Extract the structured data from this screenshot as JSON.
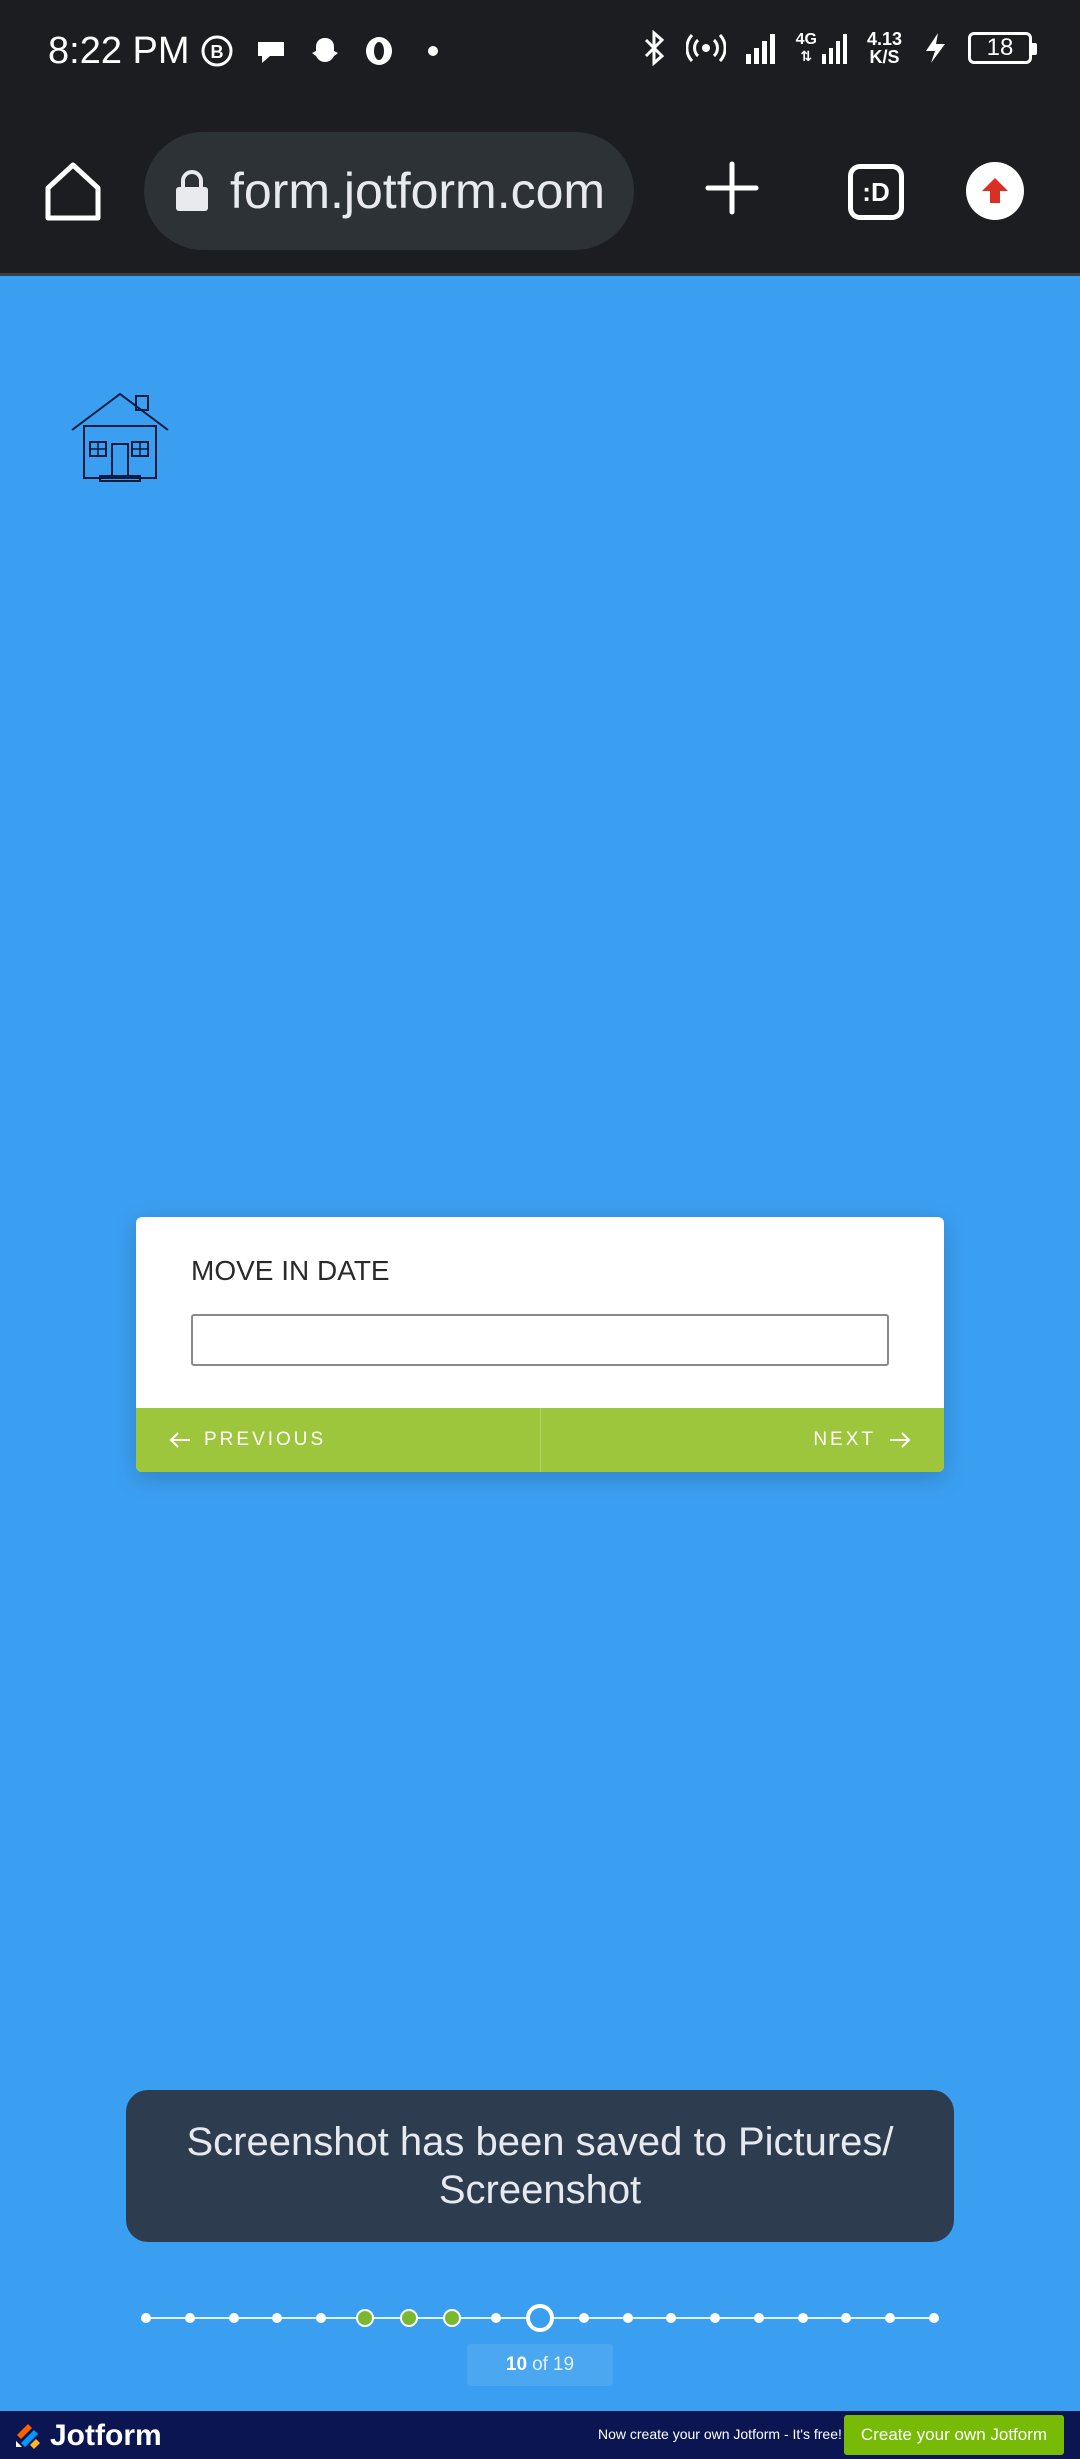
{
  "status_bar": {
    "time": "8:22 PM",
    "net_speed_value": "4.13",
    "net_speed_unit": "K/S",
    "network_type": "4G",
    "battery": "18",
    "left_icons": [
      "b-business-icon",
      "chat-bubble-icon",
      "snapchat-icon",
      "opera-icon",
      "dot-icon"
    ],
    "right_icons": [
      "bluetooth-icon",
      "hotspot-icon",
      "signal-icon",
      "signal-4g-icon",
      "charging-icon",
      "battery-icon"
    ]
  },
  "browser": {
    "url": "form.jotform.com",
    "tabs_label": ":D",
    "colors": {
      "bar": "#1b1d20",
      "pill": "#2d3237",
      "update": "#d93025"
    }
  },
  "form": {
    "field_label": "MOVE IN DATE",
    "field_value": "",
    "previous_label": "PREVIOUS",
    "next_label": "NEXT",
    "colors": {
      "background": "#3b9ff1",
      "nav": "#9dc63c",
      "done_dot": "#7ab82f"
    }
  },
  "toast": {
    "message": "Screenshot has been saved to  Pictures/ Screenshot"
  },
  "progress": {
    "current": "10",
    "of_label": "of",
    "total": "19",
    "completed_steps": [
      6,
      7,
      8
    ]
  },
  "footer": {
    "brand": "Jotform",
    "note": "Now create your own Jotform - It's free!",
    "cta": "Create your own Jotform",
    "colors": {
      "bar": "#0a1551",
      "cta": "#78bb07"
    }
  }
}
